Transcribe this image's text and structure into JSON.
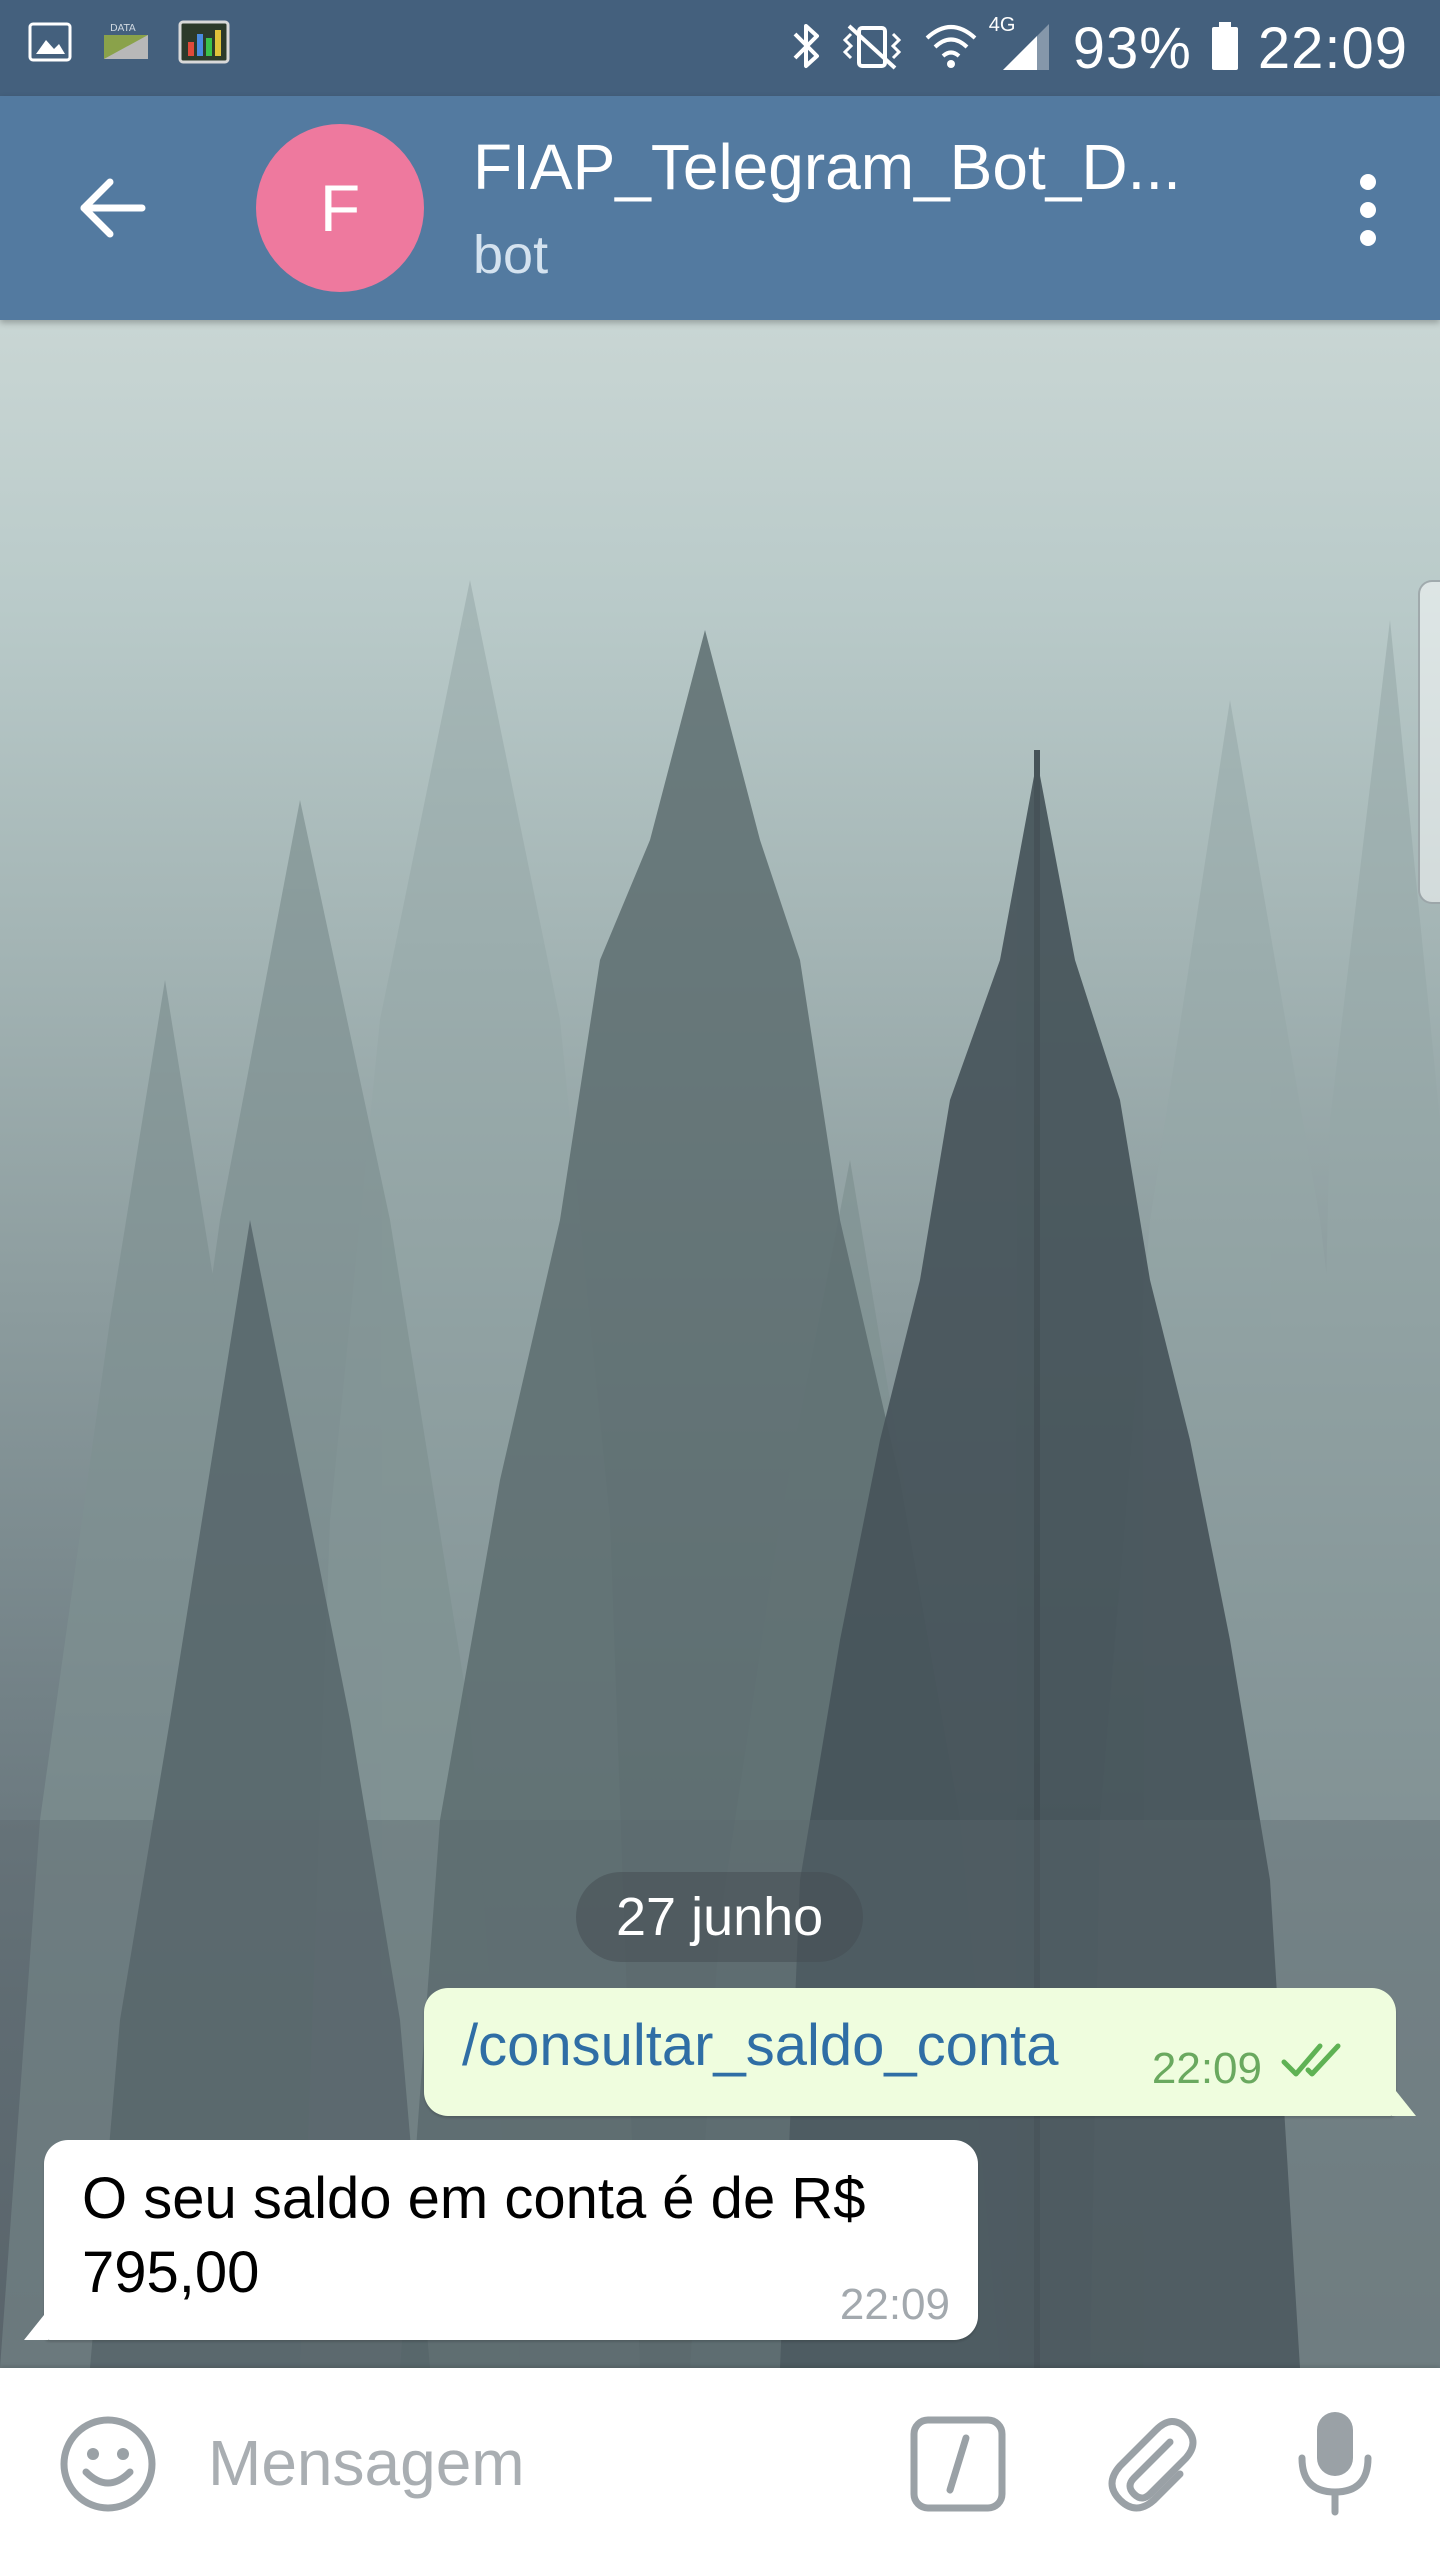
{
  "status_bar": {
    "battery": "93%",
    "time": "22:09",
    "network": "4G",
    "icons": [
      "image-notification-icon",
      "data-notification-icon",
      "chart-app-icon",
      "bluetooth-icon",
      "vibrate-icon",
      "wifi-icon",
      "signal-icon",
      "battery-icon"
    ]
  },
  "header": {
    "back_icon": "arrow-left-icon",
    "avatar_letter": "F",
    "avatar_color": "#ee799e",
    "title": "FIAP_Telegram_Bot_D...",
    "subtitle": "bot",
    "menu_icon": "more-vertical-icon",
    "bar_color": "#537aa0"
  },
  "chat": {
    "date_label": "27 junho",
    "messages": [
      {
        "direction": "outgoing",
        "text": "/consultar_saldo_conta",
        "time": "22:09",
        "status_icon": "double-check-icon"
      },
      {
        "direction": "incoming",
        "text": "O seu saldo em conta é de R$ 795,00",
        "time": "22:09"
      }
    ]
  },
  "composer": {
    "placeholder": "Mensagem",
    "emoji_icon": "smile-icon",
    "commands_icon": "slash-command-icon",
    "attach_icon": "paperclip-icon",
    "mic_icon": "microphone-icon"
  }
}
